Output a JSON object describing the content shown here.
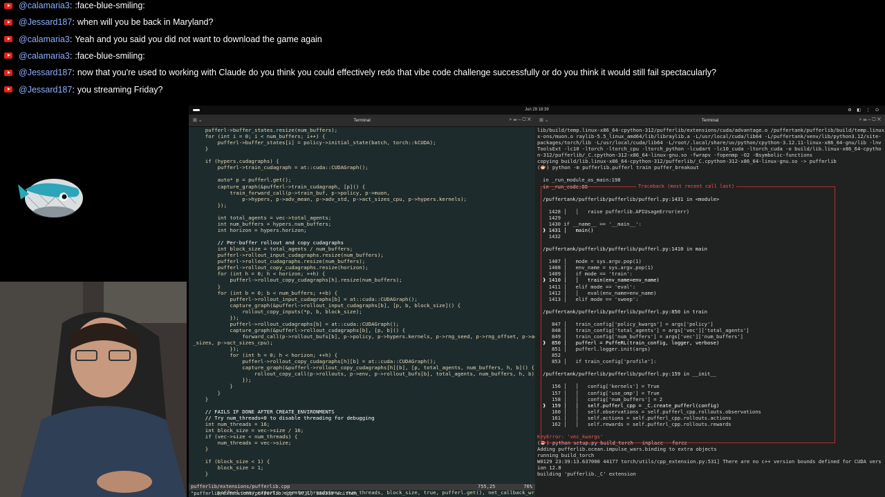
{
  "chat": [
    {
      "user": "@calamaria3",
      "text": ":face-blue-smiling:"
    },
    {
      "user": "@Jessard187",
      "text": "when will you be back in Maryland?"
    },
    {
      "user": "@calamaria3",
      "text": "Yeah and you said you did not want to download the game again"
    },
    {
      "user": "@calamaria3",
      "text": ":face-blue-smiling:"
    },
    {
      "user": "@Jessard187",
      "text": "now that you're used to working with Claude do you think you could effectively redo that vibe code challenge successfully or do you think it would still fail spectacularly?"
    },
    {
      "user": "@Jessard187",
      "text": "you streaming Friday?"
    }
  ],
  "topbar": {
    "clock": "Jun 29  18:39",
    "tray": "⚙ ◧ ⋮ ⏻"
  },
  "left_terminal": {
    "title": "Terminal",
    "lines": [
      "    pufferl->buffer_states.resize(num_buffers);",
      "    for (int i = 0; i < num_buffers; i++) {",
      "        pufferl->buffer_states[i] = policy->initial_state(batch, torch::kCUDA);",
      "    }",
      "",
      "    if (hypers.cudagraphs) {",
      "        pufferl->train_cudagraph = at::cuda::CUDAGraph();",
      "",
      "        auto* p = pufferl.get();",
      "        capture_graph(&pufferl->train_cudagraph, [p]() {",
      "            train_forward_call(p->train_buf, p->policy, p->muon,",
      "                p->hypers, p->adv_mean, p->adv_std, p->act_sizes_cpu, p->hypers.kernels);",
      "        });",
      "",
      "        int total_agents = vec->total_agents;",
      "        int num_buffers = hypers.num_buffers;",
      "        int horizon = hypers.horizon;",
      "",
      "        // Per-buffer rollout and copy cudagraphs",
      "        int block_size = total_agents / num_buffers;",
      "        pufferl->rollout_input_cudagraphs.resize(num_buffers);",
      "        pufferl->rollout_cudagraphs.resize(num_buffers);",
      "        pufferl->rollout_copy_cudagraphs.resize(horizon);",
      "        for (int h = 0; h < horizon; ++h) {",
      "            pufferl->rollout_copy_cudagraphs[h].resize(num_buffers);",
      "        }",
      "        for (int b = 0; b < num_buffers; ++b) {",
      "            pufferl->rollout_input_cudagraphs[b] = at::cuda::CUDAGraph();",
      "            capture_graph(&pufferl->rollout_input_cudagraphs[b], [p, b, block_size]() {",
      "                rollout_copy_inputs(*p, b, block_size);",
      "            });",
      "            pufferl->rollout_cudagraphs[b] = at::cuda::CUDAGraph();",
      "            capture_graph(&pufferl->rollout_cudagraphs[b], [p, b]() {",
      "                forward_call(p->rollout_bufs[b], p->policy, p->hypers.kernels, p->rng_seed, p->rng_offset, p->act",
      "_sizes, p->act_sizes_cpu);",
      "            });",
      "            for (int h = 0; h < horizon; ++h) {",
      "                pufferl->rollout_copy_cudagraphs[h][b] = at::cuda::CUDAGraph();",
      "                capture_graph(&pufferl->rollout_copy_cudagraphs[h][b], [p, total_agents, num_buffers, h, b]() {",
      "                    rollout_copy_call(p->rollouts, p->env, p->rollout_bufs[b], total_agents, num_buffers, h, b);",
      "                });",
      "            }",
      "        }",
      "    }",
      "",
      "    // FAILS IF DONE AFTER CREATE_ENVIRONMENTS",
      "    // Try num_threads=0 to disable threading for debugging",
      "    int num_threads = 16;",
      "    int block_size = vec->size / 16;",
      "    if (vec->size < num_threads) {",
      "        num_threads = vec->size;",
      "    }",
      "",
      "    if (block_size < 1) {",
      "        block_size = 1;",
      "    }",
      "",
      "    if (hypers.use_omp) {",
      "        pufferl->env_exports->create_threads(vec, num_threads, block_size, true, pufferl.get(), net_callback_wr"
    ],
    "status_file": "pufferlib/extensions/pufferlib.cpp",
    "status_pos": "755,25",
    "status_pct": "76%",
    "bottom_msg": "\"pufferlib/extensions/pufferlib.cpp\" 973L, 386398 written"
  },
  "right_terminal": {
    "title": "Terminal",
    "header_lines": [
      "lib/build/temp.linux-x86_64-cpython-312/pufferlib/extensions/cuda/advantage.o /puffertank/pufferlib/build/temp.linux-x86_64-cpython-312/pufferlib/extensions/cuda/kernels.o /puffertank/pufferlib/build/temp.linux-x86_64-cpython-312/",
      "x-ons/muon.o raylib-5.5_linux_amd64/lib/libraylib.a -L/usr/local/cuda/lib64 -L/puffertank/venv/lib/python3.12/site-",
      "packages/torch/lib -L/usr/local/cuda/lib64 -L/root/.local/share/uv/python/cpython-3.12.11-linux-x86_64-gnu/lib -lnv",
      "ToolsExt -lc10 -ltorch -ltorch_cpu -ltorch_python -lcudart -lc10_cuda -ltorch_cuda -o build/lib.linux-x86_64-cpytho",
      "n-312/pufferlib/_C.cpython-312-x86_64-linux-gnu.so -fwrapv -fopenmp -O2 -Bsymbolic-functions",
      "copying build/lib.linux-x86_64-cpython-312/pufferlib/_C.cpython-312-x86_64-linux-gnu.so -> pufferlib",
      "(🐡) python -m pufferlib.pufferl train puffer_breakout"
    ],
    "traceback_title": "Traceback (most recent call last)",
    "tb_lines": [
      "in _run_module_as_main:198",
      "in _run_code:88",
      "",
      "/puffertank/pufferlib/pufferlib/pufferl.py:1431 in <module>",
      "",
      "  1428 │   │   raise pufferlib.APIUsageError(err)",
      "  1429",
      "  1430 if __name__ == '__main__':",
      "❱ 1431 │   main()",
      "  1432",
      "",
      "/puffertank/pufferlib/pufferlib/pufferl.py:1410 in main",
      "",
      "  1407 │   mode = sys.argv.pop(1)",
      "  1408 │   env_name = sys.argv.pop(1)",
      "  1409 │   if mode == 'train':",
      "❱ 1410 │   │   train(env_name=env_name)",
      "  1411 │   elif mode == 'eval':",
      "  1412 │   │   eval(env_name=env_name)",
      "  1413 │   elif mode == 'sweep':",
      "",
      "/puffertank/pufferlib/pufferlib/pufferl.py:850 in train",
      "",
      "   847 │   train_config['policy_kwargs'] = args['policy']",
      "   848 │   train_config['total_agents'] = args['vec']['total_agents']",
      "   849 │   train_config['num_buffers'] = args['vec']['num_buffers']",
      "❱  850 │   pufferl = PuffeRL(train_config, logger, verbose)",
      "   851 │   pufferl.logger.init(args)",
      "   852",
      "   853 │   if train_config['profile']:",
      "",
      "/puffertank/pufferlib/pufferlib/pufferl.py:159 in __init__",
      "",
      "   156 │   │   config['kernels'] = True",
      "   157 │   │   config['use_omp'] = True",
      "   158 │   │   config['num_buffers'] = 2",
      "❱  159 │   │   self.pufferl_cpp = _C.create_pufferl(config)",
      "   160 │   │   self.observations = self.pufferl_cpp.rollouts.observations",
      "   161 │   │   self.actions = self.pufferl_cpp.rollouts.actions",
      "   162 │   │   self.rewards = self.pufferl_cpp.rollouts.rewards"
    ],
    "footer_lines": [
      "KeyError: 'vec_kwargs'",
      "(🐡) python setup.py build_torch --inplace --force",
      "Adding pufferlib.ocean.impulse_wars.binding to extra objects",
      "running build_torch",
      "W0129 23:39:13.637000 44177 torch/utils/cpp_extension.py:531] There are no c++ version bounds defined for CUDA vers",
      "ion 12.8",
      "building 'pufferlib._C' extension"
    ]
  },
  "colors": {
    "accent_user": "#8fb0ff",
    "youtube_red": "#e62117",
    "error_red": "#ff5050"
  }
}
